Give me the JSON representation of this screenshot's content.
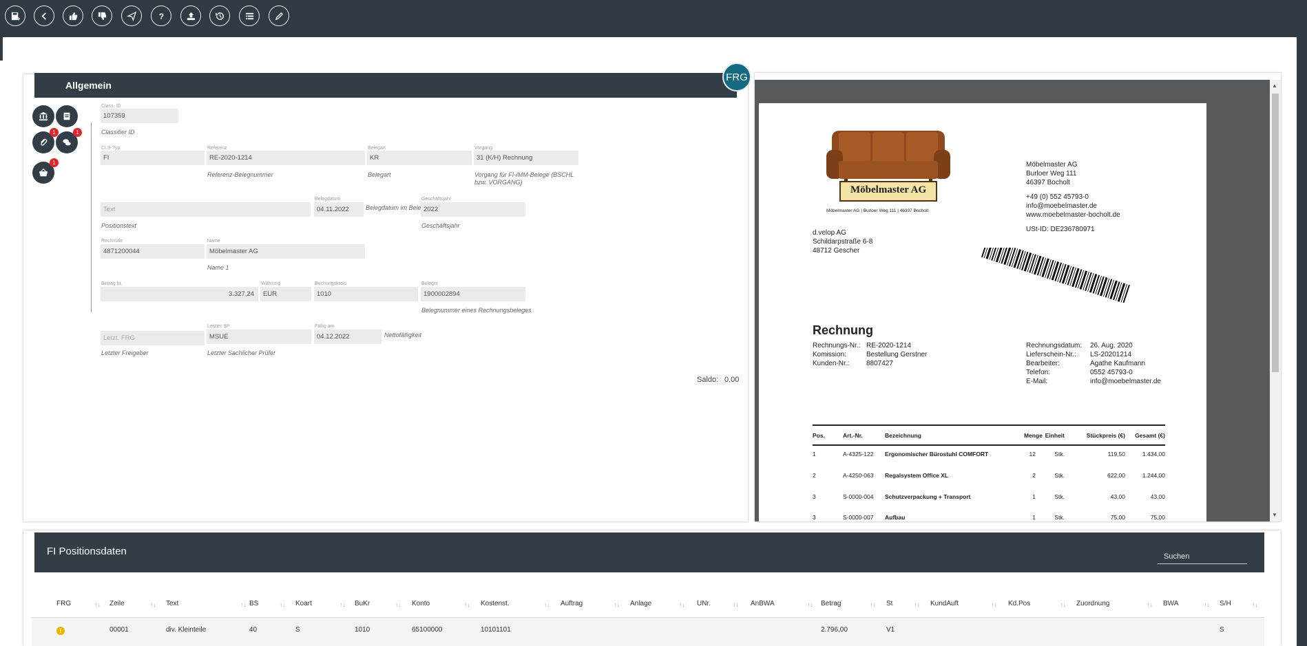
{
  "toolbar": {
    "buttons": [
      "save-icon",
      "back-icon",
      "thumbs-up-icon",
      "thumbs-down-icon",
      "send-icon",
      "help-icon",
      "upload-icon",
      "history-icon",
      "list-icon",
      "edit-icon"
    ]
  },
  "badge": {
    "frg": "FRG"
  },
  "form": {
    "title": "Allgemein",
    "side_badges": {
      "attach": "1",
      "chat": "1",
      "basket": "1"
    },
    "class_id": {
      "label": "Class. ID",
      "value": "107359",
      "hint": "Classifier ID"
    },
    "cls_typ": {
      "label": "CLS-Typ",
      "value": "FI"
    },
    "referenz": {
      "label": "Referenz",
      "value": "RE-2020-1214",
      "hint": "Referenz-Belegnummer"
    },
    "belegart": {
      "label": "Belegart",
      "value": "KR",
      "hint": "Belegart"
    },
    "vorgang": {
      "label": "Vorgang",
      "value": "31 (K/H) Rechnung",
      "hint": "Vorgang für FI-/MM-Belege (BSCHL bzw. VORGANG)"
    },
    "text": {
      "placeholder": "Text",
      "hint": "Positionstext"
    },
    "belegdatum": {
      "label": "Belegdatum",
      "value": "04.11.2022",
      "hint": "Belegdatum im Beleg"
    },
    "geschaeftsjahr": {
      "label": "Geschäftsjahr",
      "value": "2022",
      "hint": "Geschäftsjahr"
    },
    "rechnsteller": {
      "label": "Rechnstle",
      "value": "4871200044"
    },
    "name": {
      "label": "Name",
      "value": "Möbelmaster AG",
      "hint": "Name 1"
    },
    "betrag": {
      "label": "Betrag br.",
      "value": "3.327,24"
    },
    "waehrung": {
      "label": "Währung",
      "value": "EUR"
    },
    "buchungskreis": {
      "label": "Buchungskreis",
      "value": "1010"
    },
    "belegnr": {
      "label": "Belegnr",
      "value": "1900002894",
      "hint": "Belegnummer eines Rechnungsbeleges"
    },
    "letzt_frg": {
      "placeholder": "Letzt. FRG",
      "hint": "Letzter Freigeber"
    },
    "letzter_sp": {
      "label": "Letzter SP",
      "value": "MSUE",
      "hint": "Letzter Sachlicher Prüfer"
    },
    "faellig": {
      "label": "Fällig am",
      "value": "04.12.2022",
      "hint": "Nettofälligkeit"
    },
    "saldo_label": "Saldo:",
    "saldo_value": "0,00"
  },
  "invoice": {
    "logo_text": "Möbelmaster AG",
    "sender_line": "Möbelmaster AG | Burloer Weg 111 | 46397 Bocholt",
    "company": [
      "Möbelmaster AG",
      "Burloer Weg 111",
      "46397 Bocholt"
    ],
    "contact": [
      "+49 (0) 552 45793-0",
      "info@moebelmaster.de",
      "www.moebelmaster-bocholt.de"
    ],
    "ust": "USt-ID: DE236780971",
    "recipient": [
      "d.velop AG",
      "Schildarpstraße 6-8",
      "48712 Gescher"
    ],
    "title": "Rechnung",
    "meta_left": [
      [
        "Rechnungs-Nr.:",
        "RE-2020-1214"
      ],
      [
        "Komission:",
        "Bestellung Gerstner"
      ],
      [
        "Kunden-Nr.:",
        "8807427"
      ]
    ],
    "meta_right": [
      [
        "Rechnungsdatum:",
        "26. Aug. 2020"
      ],
      [
        "Lieferschein-Nr.:",
        "LS-20201214"
      ],
      [
        "Bearbeiter:",
        "Agathe Kaufmann"
      ],
      [
        "Telefon:",
        "0552 45793-0"
      ],
      [
        "E-Mail:",
        "info@moebelmaster.de"
      ]
    ],
    "columns": [
      "Pos.",
      "Art.-Nr.",
      "Bezeichnung",
      "Menge",
      "Einheit",
      "Stückpreis (€)",
      "Gesamt (€)"
    ],
    "rows": [
      [
        "1",
        "A-4325-122",
        "Ergonomischer Bürostuhl COMFORT",
        "12",
        "Stk.",
        "119,50",
        "1.434,00"
      ],
      [
        "2",
        "A-4250-063",
        "Regalsystem Office XL",
        "2",
        "Stk.",
        "622,00",
        "1.244,00"
      ],
      [
        "3",
        "S-0000-004",
        "Schutzverpackung + Transport",
        "1",
        "Stk.",
        "43,00",
        "43,00"
      ],
      [
        "3",
        "S-0000-007",
        "Aufbau",
        "1",
        "Stk.",
        "75,00",
        "75,00"
      ]
    ]
  },
  "fi": {
    "title": "FI Positionsdaten",
    "search_placeholder": "Suchen",
    "columns": [
      "FRG",
      "Zeile",
      "Text",
      "BS",
      "Koart",
      "BuKr",
      "Konto",
      "Kostenst.",
      "Auftrag",
      "Anlage",
      "UNr.",
      "AnBWA",
      "Betrag",
      "St",
      "KundAuft",
      "Kd.Pos",
      "Zuordnung",
      "BWA",
      "S/H"
    ],
    "row": {
      "Zeile": "00001",
      "Text": "div. Kleinteile",
      "BS": "40",
      "Koart": "S",
      "BuKr": "1010",
      "Konto": "65100000",
      "Kostenst": "10101101",
      "Betrag": "2.796,00",
      "St": "V1",
      "SH": "S"
    }
  }
}
